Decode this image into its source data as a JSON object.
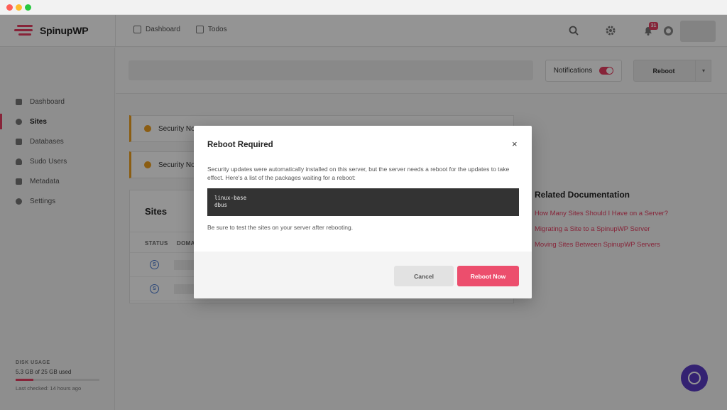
{
  "app": {
    "logo_text": "SpinupWP",
    "nav": {
      "dashboard": "Dashboard",
      "todos": "Todos"
    },
    "notifications_badge": "31",
    "accent_color": "#e83f62"
  },
  "sidebar": {
    "items": [
      {
        "label": "Dashboard",
        "icon": "dashboard-icon"
      },
      {
        "label": "Sites",
        "icon": "globe-icon",
        "active": true
      },
      {
        "label": "Databases",
        "icon": "database-icon"
      },
      {
        "label": "Sudo Users",
        "icon": "user-icon"
      },
      {
        "label": "Metadata",
        "icon": "document-icon"
      },
      {
        "label": "Settings",
        "icon": "gear-icon"
      }
    ],
    "disk": {
      "title": "DISK USAGE",
      "usage": "5.3 GB of 25 GB used",
      "fraction_used": 0.212,
      "last_checked": "Last checked: 14 hours ago"
    }
  },
  "toolbar": {
    "notifications_label": "Notifications",
    "notifications_on": true,
    "reboot_label": "Reboot"
  },
  "alerts": [
    {
      "text": "Security No"
    },
    {
      "text": "Security No"
    }
  ],
  "sites": {
    "title": "Sites",
    "columns": {
      "status": "STATUS",
      "domain": "DOMA"
    },
    "rows": [
      {
        "badge": "S"
      },
      {
        "badge": "S"
      }
    ]
  },
  "related": {
    "title": "Related Documentation",
    "links": [
      "How Many Sites Should I Have on a Server?",
      "Migrating a Site to a SpinupWP Server",
      "Moving Sites Between SpinupWP Servers"
    ]
  },
  "modal": {
    "title": "Reboot Required",
    "close": "×",
    "text": "Security updates were automatically installed on this server, but the server needs a reboot for the updates to take effect. Here's a list of the packages waiting for a reboot:",
    "packages": [
      "linux-base",
      "dbus"
    ],
    "note": "Be sure to test the sites on your server after rebooting.",
    "cancel_label": "Cancel",
    "confirm_label": "Reboot Now"
  }
}
